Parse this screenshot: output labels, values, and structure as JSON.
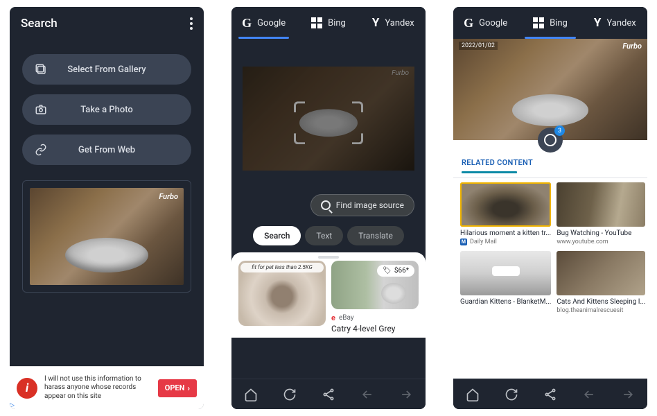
{
  "screen1": {
    "title": "Search",
    "buttons": {
      "gallery": "Select From Gallery",
      "photo": "Take a Photo",
      "web": "Get From Web"
    },
    "preview": {
      "watermark": "Furbo"
    },
    "ad": {
      "text": "I will not use this information to harass anyone whose records appear on this site",
      "cta": "OPEN"
    }
  },
  "tabs": {
    "google": "Google",
    "bing": "Bing",
    "yandex": "Yandex"
  },
  "screen2": {
    "watermark": "Furbo",
    "find_source": "Find image source",
    "modes": {
      "search": "Search",
      "text": "Text",
      "translate": "Translate"
    },
    "products": [
      {
        "caption": "fit for pet less than 2.5KG"
      },
      {
        "price": "$66*",
        "store": "eBay",
        "title": "Catry 4-level Grey"
      }
    ]
  },
  "screen3": {
    "date": "2022/01/02",
    "watermark": "Furbo",
    "lens_count": "3",
    "related_heading": "RELATED CONTENT",
    "results": [
      {
        "title": "Hilarious moment a kitten tr...",
        "source": "Daily Mail",
        "source_icon": "M"
      },
      {
        "title": "Bug Watching - YouTube",
        "source": "www.youtube.com"
      },
      {
        "title": "Guardian Kittens - BlanketM...",
        "source": ""
      },
      {
        "title": "Cats And Kittens Sleeping I...",
        "source": "blog.theanimalrescuesit"
      }
    ]
  }
}
